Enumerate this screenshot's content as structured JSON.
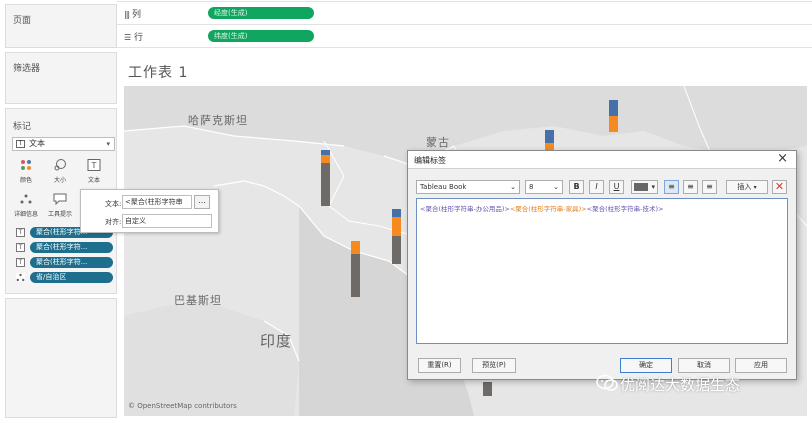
{
  "sidebar": {
    "pages_title": "页面",
    "filters_title": "筛选器",
    "marks_title": "标记",
    "mark_type": "文本",
    "mark_buttons": [
      {
        "label": "颜色",
        "icon": "color-dots-icon"
      },
      {
        "label": "大小",
        "icon": "size-icon"
      },
      {
        "label": "文本",
        "icon": "text-icon"
      },
      {
        "label": "详细信息",
        "icon": "detail-icon"
      },
      {
        "label": "工具提示",
        "icon": "tooltip-icon"
      }
    ],
    "mark_pills": [
      {
        "icon": "text-icon",
        "label": "聚合(柱形字符..."
      },
      {
        "icon": "text-icon",
        "label": "聚合(柱形字符..."
      },
      {
        "icon": "text-icon",
        "label": "聚合(柱形字符..."
      },
      {
        "icon": "detail-icon",
        "label": "省/自治区"
      }
    ]
  },
  "shelves": {
    "columns_label": "列",
    "columns_pill": "经度(生成)",
    "rows_label": "行",
    "rows_pill": "纬度(生成)"
  },
  "sheet": {
    "title": "工作表 1"
  },
  "map": {
    "labels": {
      "kazakhstan": "哈萨克斯坦",
      "mongolia": "蒙古",
      "pakistan": "巴基斯坦",
      "india": "印度"
    },
    "attribution": "© OpenStreetMap contributors",
    "segment_colors": {
      "office": "#6d6a68",
      "furniture": "#f48a20",
      "tech": "#4670a8"
    },
    "stacked_bar_values": [
      {
        "region": "xinjiang",
        "tech": 0.08,
        "furniture": 0.15,
        "office": 0.77
      },
      {
        "region": "tibet",
        "tech": 0.0,
        "furniture": 0.23,
        "office": 0.77
      },
      {
        "region": "qinghai",
        "tech": 0.15,
        "furniture": 0.35,
        "office": 0.5
      },
      {
        "region": "inner-mongolia-1",
        "tech": 0.6,
        "furniture": 0.4,
        "office": 0.0
      },
      {
        "region": "inner-mongolia-2",
        "tech": 0.5,
        "furniture": 0.5,
        "office": 0.0
      }
    ]
  },
  "label_popup": {
    "text_label": "文本:",
    "text_value": "<聚合(柱形字符串",
    "more_button": "...",
    "align_label": "对齐:",
    "align_value": "自定义"
  },
  "dialog": {
    "title": "编辑标签",
    "close": "×",
    "font_name": "Tableau Book",
    "font_size": "8",
    "bold": "B",
    "italic": "I",
    "underline": "U",
    "align_left": "≡",
    "align_center": "≡",
    "align_right": "≡",
    "insert_label": "插入",
    "tokens": [
      {
        "text": "<聚合(柱形字符串-办公用品)>",
        "color": "#6a55b0"
      },
      {
        "text": "<聚合(柱形字符串-家具)>",
        "color": "#e47f1a"
      },
      {
        "text": "<聚合(柱形字符串-技术)>",
        "color": "#6a55b0"
      }
    ],
    "buttons": {
      "reset": "重置(R)",
      "preview": "预览(P)",
      "ok": "确定",
      "cancel": "取消",
      "apply": "应用"
    }
  },
  "watermark": {
    "text": "优阅达大数据生态"
  }
}
